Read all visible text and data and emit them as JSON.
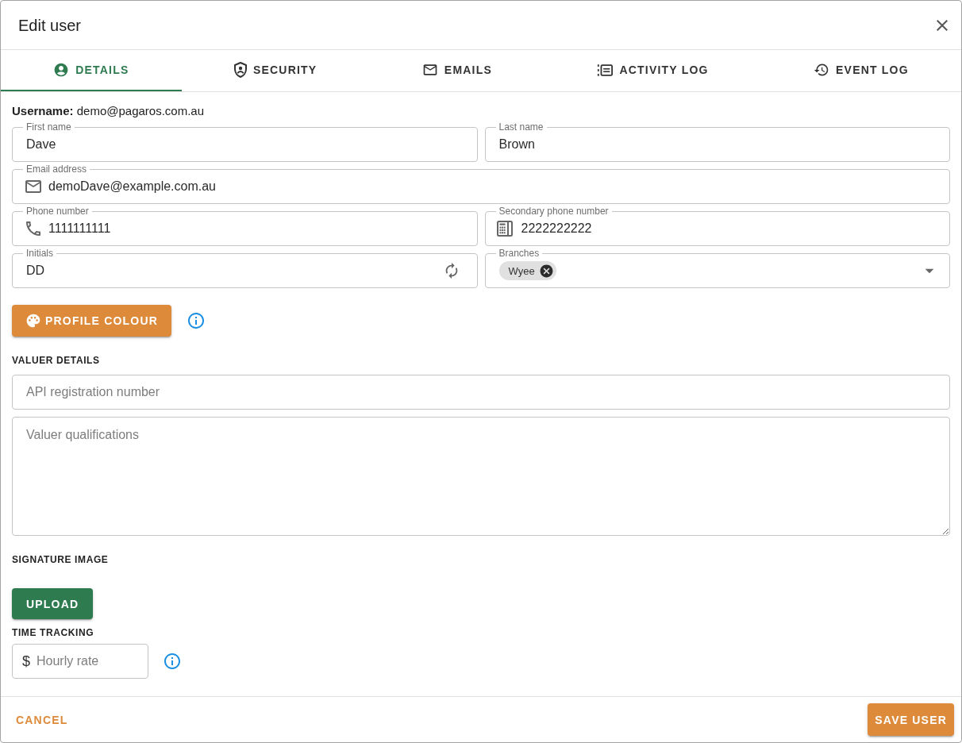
{
  "dialog": {
    "title": "Edit user"
  },
  "tabs": [
    {
      "label": "DETAILS",
      "selected": true
    },
    {
      "label": "SECURITY",
      "selected": false
    },
    {
      "label": "EMAILS",
      "selected": false
    },
    {
      "label": "ACTIVITY LOG",
      "selected": false
    },
    {
      "label": "EVENT LOG",
      "selected": false
    }
  ],
  "username": "**Username:** demo@pagaros.com.au",
  "field_rows": [
    {
      "fields": [
        {
          "kind": "text",
          "label": "First name",
          "value": "Dave"
        },
        {
          "kind": "text",
          "label": "Last name",
          "value": "Brown"
        }
      ]
    },
    {
      "fields": [
        {
          "kind": "email",
          "label": "Email address",
          "value": "demoDave@example.com.au"
        }
      ]
    },
    {
      "fields": [
        {
          "kind": "phone",
          "label": "Phone number",
          "value": "1111111111"
        },
        {
          "kind": "fax",
          "label": "Secondary phone number",
          "value": "2222222222"
        }
      ]
    },
    {
      "fields": [
        {
          "kind": "initials",
          "label": "Initials",
          "value": "DD"
        },
        {
          "kind": "select",
          "label": "Branches",
          "chips": [
            "Wyee"
          ]
        }
      ]
    }
  ],
  "profile_colour": {
    "button": "PROFILE COLOUR"
  },
  "valuer_details": {
    "heading": "VALUER DETAILS",
    "registration": {
      "placeholder": "API registration number"
    },
    "qualifications": {
      "placeholder": "Valuer qualifications"
    }
  },
  "signature_image": {
    "heading": "SIGNATURE IMAGE",
    "button": "UPLOAD"
  },
  "time_tracking": {
    "heading": "TIME TRACKING",
    "rate": {
      "prefix": "$",
      "placeholder": "Hourly rate"
    }
  },
  "actions": {
    "cancel": "CANCEL",
    "save": "SAVE USER"
  }
}
